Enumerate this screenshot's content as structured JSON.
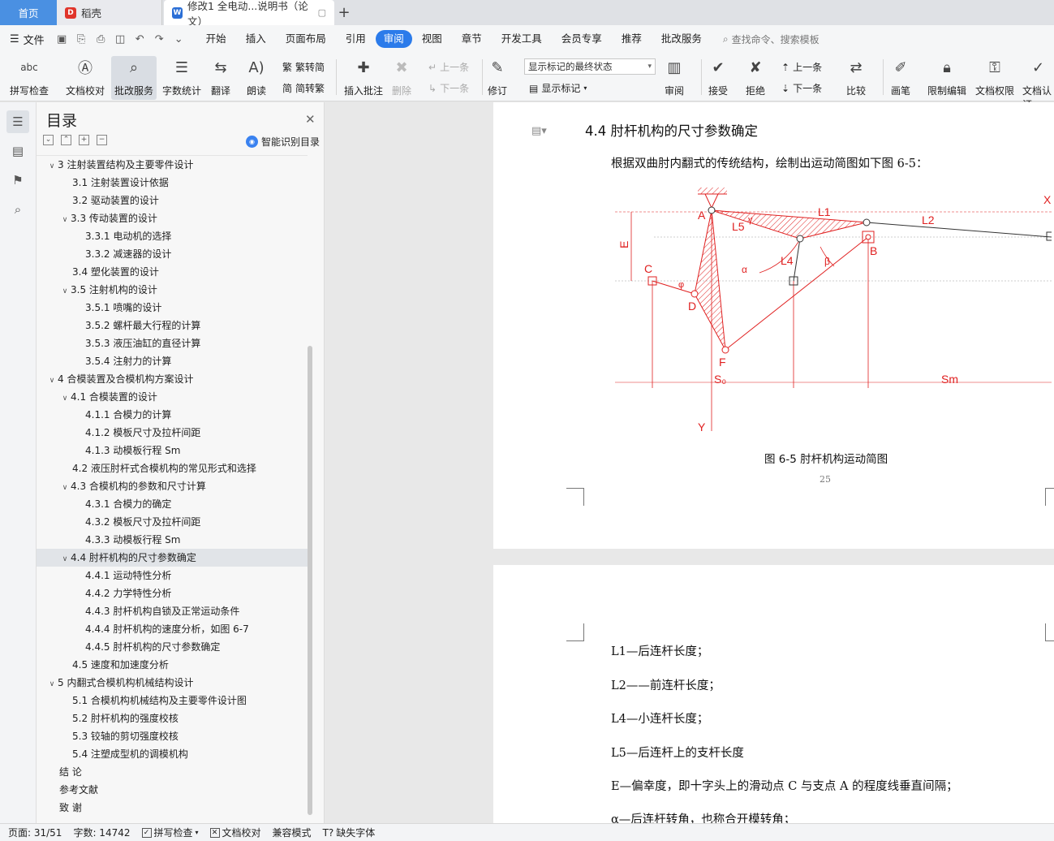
{
  "tabs": {
    "home": "首页",
    "daoke": "稻壳",
    "doc": "修改1 全电动...说明书（论文）",
    "add": "+"
  },
  "menubar": {
    "file": "文件",
    "items": [
      "开始",
      "插入",
      "页面布局",
      "引用",
      "审阅",
      "视图",
      "章节",
      "开发工具",
      "会员专享",
      "推荐",
      "批改服务"
    ],
    "active": "审阅",
    "search_placeholder": "查找命令、搜索模板"
  },
  "ribbon": {
    "spellcheck": "拼写检查",
    "doccheck": "文档校对",
    "correction": "批改服务",
    "wordcount": "字数统计",
    "translate": "翻译",
    "read": "朗读",
    "trad": "繁转简",
    "simp": "简转繁",
    "insert_comment": "插入批注",
    "delete": "删除",
    "prev": "上一条",
    "next": "下一条",
    "revise": "修订",
    "markup_state": "显示标记的最终状态",
    "show_markup": "显示标记",
    "review": "审阅",
    "accept": "接受",
    "reject": "拒绝",
    "prev2": "上一条",
    "next2": "下一条",
    "compare": "比较",
    "pen": "画笔",
    "restrict": "限制编辑",
    "perm": "文档权限",
    "auth": "文档认证",
    "abc": "abc"
  },
  "toc": {
    "title": "目录",
    "smart": "智能识别目录",
    "items": [
      {
        "label": "3  注射装置结构及主要零件设计",
        "level": 1,
        "arrow": true
      },
      {
        "label": "3.1 注射装置设计依据",
        "level": 2,
        "arrow": false
      },
      {
        "label": "3.2  驱动装置的设计",
        "level": 2,
        "arrow": false
      },
      {
        "label": "3.3 传动装置的设计",
        "level": 2,
        "arrow": true
      },
      {
        "label": "3.3.1 电动机的选择",
        "level": 3,
        "arrow": false
      },
      {
        "label": "3.3.2 减速器的设计",
        "level": 3,
        "arrow": false
      },
      {
        "label": "3.4 塑化装置的设计",
        "level": 2,
        "arrow": false
      },
      {
        "label": "3.5 注射机构的设计",
        "level": 2,
        "arrow": true
      },
      {
        "label": "3.5.1 喷嘴的设计",
        "level": 3,
        "arrow": false
      },
      {
        "label": "3.5.2 螺杆最大行程的计算",
        "level": 3,
        "arrow": false
      },
      {
        "label": "3.5.3 液压油缸的直径计算",
        "level": 3,
        "arrow": false
      },
      {
        "label": "3.5.4 注射力的计算",
        "level": 3,
        "arrow": false
      },
      {
        "label": "4  合模装置及合模机构方案设计",
        "level": 1,
        "arrow": true
      },
      {
        "label": "4.1  合模装置的设计",
        "level": 2,
        "arrow": true
      },
      {
        "label": "4.1.1 合模力的计算",
        "level": 3,
        "arrow": false
      },
      {
        "label": "4.1.2 模板尺寸及拉杆间距",
        "level": 3,
        "arrow": false
      },
      {
        "label": "4.1.3 动模板行程 Sm",
        "level": 3,
        "arrow": false
      },
      {
        "label": "4.2  液压肘杆式合模机构的常见形式和选择",
        "level": 2,
        "arrow": false
      },
      {
        "label": "4.3 合模机构的参数和尺寸计算",
        "level": 2,
        "arrow": true
      },
      {
        "label": "4.3.1 合模力的确定",
        "level": 3,
        "arrow": false
      },
      {
        "label": "4.3.2  模板尺寸及拉杆间距",
        "level": 3,
        "arrow": false
      },
      {
        "label": "4.3.3  动模板行程 Sm",
        "level": 3,
        "arrow": false
      },
      {
        "label": "4.4  肘杆机构的尺寸参数确定",
        "level": 2,
        "arrow": true,
        "selected": true
      },
      {
        "label": "4.4.1 运动特性分析",
        "level": 3,
        "arrow": false
      },
      {
        "label": "4.4.2 力学特性分析",
        "level": 3,
        "arrow": false
      },
      {
        "label": "4.4.3 肘杆机构自锁及正常运动条件",
        "level": 3,
        "arrow": false
      },
      {
        "label": "4.4.4 肘杆机构的速度分析，如图 6-7",
        "level": 3,
        "arrow": false
      },
      {
        "label": "4.4.5 肘杆机构的尺寸参数确定",
        "level": 3,
        "arrow": false
      },
      {
        "label": "4.5  速度和加速度分析",
        "level": 2,
        "arrow": false
      },
      {
        "label": "5  内翻式合模机构机械结构设计",
        "level": 1,
        "arrow": true
      },
      {
        "label": "5.1  合模机构机械结构及主要零件设计图",
        "level": 2,
        "arrow": false
      },
      {
        "label": "5.2  肘杆机构的强度校核",
        "level": 2,
        "arrow": false
      },
      {
        "label": "5.3 铰轴的剪切强度校核",
        "level": 2,
        "arrow": false
      },
      {
        "label": "5.4  注塑成型机的调模机构",
        "level": 2,
        "arrow": false
      },
      {
        "label": "结    论",
        "level": 0,
        "arrow": false
      },
      {
        "label": "参考文献",
        "level": 0,
        "arrow": false
      },
      {
        "label": "致    谢",
        "level": 0,
        "arrow": false
      }
    ]
  },
  "document": {
    "heading": "4.4  肘杆机构的尺寸参数确定",
    "intro": "根据双曲肘内翻式的传统结构，绘制出运动简图如下图 6-5：",
    "caption": "图 6-5 肘杆机构运动简图",
    "page_number": "25",
    "labels": {
      "A": "A",
      "B": "B",
      "C": "C",
      "D": "D",
      "F": "F",
      "L1": "L1",
      "L2": "L2",
      "L4": "L4",
      "L5": "L5",
      "E": "E",
      "X": "X",
      "Y": "Y",
      "S0": "S₀",
      "Sm": "Sm",
      "alpha": "α",
      "beta": "β",
      "phi": "φ",
      "gamma": "γ"
    },
    "defs": [
      "L1—后连杆长度；",
      "L2——前连杆长度；",
      "L4—小连杆长度；",
      "L5—后连杆上的支杆长度",
      "E—偏幸度，即十字头上的滑动点 C 与支点 A 的程度线垂直间隔；",
      "α—后连杆转角，也称合开模转角；"
    ]
  },
  "status": {
    "page": "页面: 31/51",
    "words": "字数: 14742",
    "spell": "拼写检查",
    "doccheck": "文档校对",
    "compat": "兼容模式",
    "missing_font": "缺失字体"
  },
  "colors": {
    "accent": "#2b7bea",
    "diagram_red": "#e02020"
  }
}
